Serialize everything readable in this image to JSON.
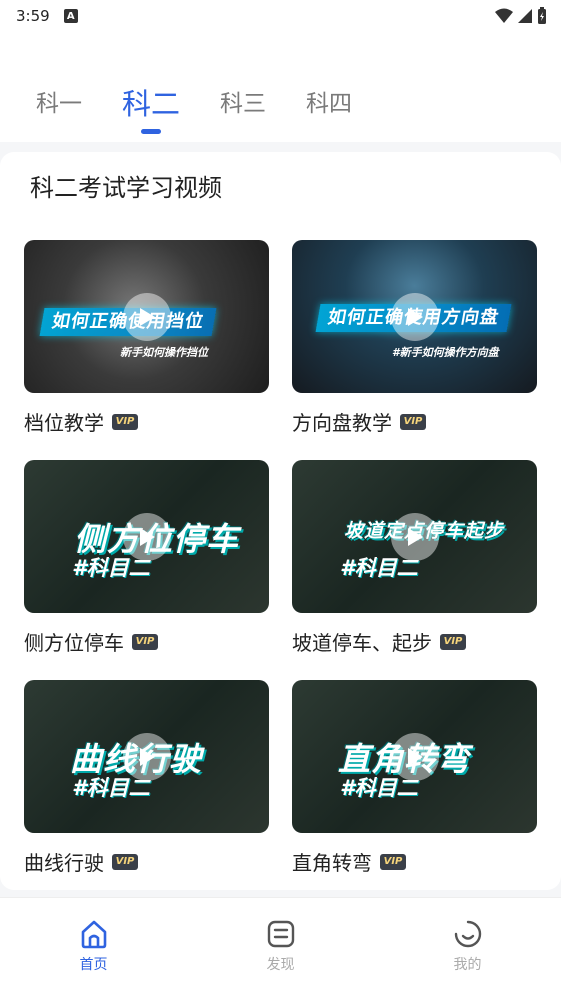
{
  "status_bar": {
    "time": "3:59",
    "notification_letter": "A"
  },
  "tabs": [
    {
      "label": "科一",
      "active": false
    },
    {
      "label": "科二",
      "active": true
    },
    {
      "label": "科三",
      "active": false
    },
    {
      "label": "科四",
      "active": false
    }
  ],
  "section": {
    "title": "科二考试学习视频"
  },
  "videos": [
    {
      "title": "档位教学",
      "thumb_headline": "如何正确使用挡位",
      "thumb_sub": "新手如何操作挡位",
      "vip": "VIP"
    },
    {
      "title": "方向盘教学",
      "thumb_headline": "如何正确使用方向盘",
      "thumb_sub": "#新手如何操作方向盘",
      "vip": "VIP"
    },
    {
      "title": "侧方位停车",
      "thumb_headline": "侧方位停车",
      "thumb_sub": "#科目二",
      "vip": "VIP"
    },
    {
      "title": "坡道停车、起步",
      "thumb_headline": "坡道定点停车起步",
      "thumb_sub": "#科目二",
      "vip": "VIP"
    },
    {
      "title": "曲线行驶",
      "thumb_headline": "曲线行驶",
      "thumb_sub": "#科目二",
      "vip": "VIP"
    },
    {
      "title": "直角转弯",
      "thumb_headline": "直角转弯",
      "thumb_sub": "#科目二",
      "vip": "VIP"
    }
  ],
  "bottom_nav": [
    {
      "label": "首页",
      "icon": "home-icon",
      "active": true
    },
    {
      "label": "发现",
      "icon": "discover-icon",
      "active": false
    },
    {
      "label": "我的",
      "icon": "profile-icon",
      "active": false
    }
  ],
  "colors": {
    "accent": "#2f63e0",
    "vip_bg": "#3a3f48",
    "vip_text": "#f4d37a"
  }
}
